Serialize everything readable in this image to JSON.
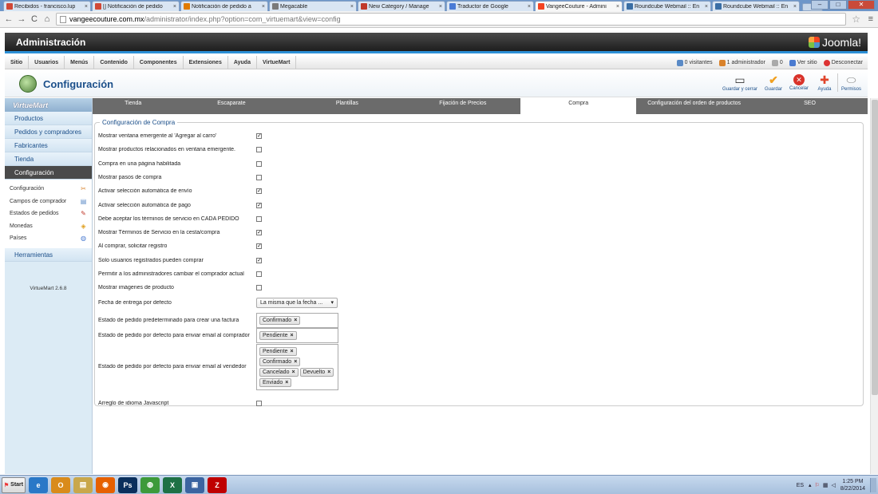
{
  "browser": {
    "tabs": [
      {
        "label": "Recibidos - francisco.lup",
        "icon": "gmail-icon",
        "color": "#d14836",
        "active": false
      },
      {
        "label": "[] Notificación de pedido",
        "icon": "gmail-icon",
        "color": "#d14836",
        "active": false
      },
      {
        "label": "Notificación de pedido a",
        "icon": "w-icon",
        "color": "#e07b00",
        "active": false
      },
      {
        "label": "Megacable",
        "icon": "megacable-icon",
        "color": "#7a7a7a",
        "active": false
      },
      {
        "label": "New Category / Manage",
        "icon": "manage-icon",
        "color": "#c0392b",
        "active": false
      },
      {
        "label": "Traductor de Google",
        "icon": "translate-icon",
        "color": "#4a7bd6",
        "active": false
      },
      {
        "label": "VangeeCouture - Admini",
        "icon": "joomla-icon",
        "color": "#f44321",
        "active": true
      },
      {
        "label": "Roundcube Webmail :: En",
        "icon": "roundcube-icon",
        "color": "#3a6ea5",
        "active": false
      },
      {
        "label": "Roundcube Webmail :: En",
        "icon": "roundcube-icon",
        "color": "#3a6ea5",
        "active": false
      }
    ],
    "url_host": "vangeecouture.com.mx",
    "url_path": "/administrator/index.php?option=com_virtuemart&view=config"
  },
  "header": {
    "title": "Administración",
    "logo": "Joomla!"
  },
  "menubar": {
    "items": [
      "Sitio",
      "Usuarios",
      "Menús",
      "Contenido",
      "Componentes",
      "Extensiones",
      "Ayuda",
      "VirtueMart"
    ],
    "visitors": "0 visitantes",
    "admins": "1 administrador",
    "messages": "0",
    "view_site": "Ver sitio",
    "logout": "Desconectar"
  },
  "page": {
    "title": "Configuración"
  },
  "toolbar": {
    "save_close": "Guardar y cerrar",
    "save": "Guardar",
    "cancel": "Cancelar",
    "help": "Ayuda",
    "permissions": "Permisos"
  },
  "sidebar": {
    "logo": "VirtueMart",
    "items": [
      "Productos",
      "Pedidos y compradores",
      "Fabricantes",
      "Tienda",
      "Configuración"
    ],
    "active_item": "Configuración",
    "subitems": [
      {
        "label": "Configuración",
        "icon": "tools-icon"
      },
      {
        "label": "Campos de comprador",
        "icon": "form-icon"
      },
      {
        "label": "Estados de pedidos",
        "icon": "status-icon"
      },
      {
        "label": "Monedas",
        "icon": "coins-icon"
      },
      {
        "label": "Países",
        "icon": "globe-icon"
      }
    ],
    "tools": "Herramientas",
    "version": "VirtueMart 2.6.8"
  },
  "tabs": [
    {
      "label": "Tienda",
      "active": false
    },
    {
      "label": "Escaparate",
      "active": false
    },
    {
      "label": "Plantillas",
      "active": false
    },
    {
      "label": "Fijación de Precios",
      "active": false
    },
    {
      "label": "Compra",
      "active": true
    },
    {
      "label": "Configuración del orden de productos",
      "active": false
    },
    {
      "label": "SEO",
      "active": false
    }
  ],
  "form": {
    "legend": "Configuración de Compra",
    "checkboxes": [
      {
        "label": "Mostrar ventana emergente al 'Agregar al carro'",
        "checked": true
      },
      {
        "label": "Mostrar productos relacionados en ventana emergente.",
        "checked": false
      },
      {
        "label": "Compra en una página habilitada",
        "checked": false
      },
      {
        "label": "Mostrar pasos de compra",
        "checked": false
      },
      {
        "label": "Activar selección automática de envío",
        "checked": true
      },
      {
        "label": "Activar selección automática de pago",
        "checked": true
      },
      {
        "label": "Debe aceptar los términos de servicio en CADA PEDIDO",
        "checked": false
      },
      {
        "label": "Mostrar Términos de Servicio en la cesta/compra",
        "checked": true
      },
      {
        "label": "Al comprar, solicitar registro",
        "checked": true
      },
      {
        "label": "Solo usuarios registrados pueden comprar",
        "checked": true
      },
      {
        "label": "Permitir a los administradores cambiar el comprador actual",
        "checked": false
      },
      {
        "label": "Mostrar imágenes de producto",
        "checked": false
      }
    ],
    "delivery": {
      "label": "Fecha de entrega por defecto",
      "value": "La misma que la fecha ..."
    },
    "invoice": {
      "label": "Estado de pedido predeterminado para crear una factura",
      "chips": [
        "Confirmado"
      ]
    },
    "email_buyer": {
      "label": "Estado de pedido por defecto para enviar email al comprador",
      "chips": [
        "Pendiente"
      ]
    },
    "email_vendor": {
      "label": "Estado de pedido por defecto para enviar email al vendedor",
      "chips": [
        "Pendiente",
        "Confirmado",
        "Cancelado",
        "Devuelto",
        "Enviado"
      ]
    },
    "js_fix": {
      "label": "Arreglo de idioma Javascript",
      "checked": false
    }
  },
  "taskbar": {
    "start": "Start",
    "apps": [
      {
        "icon": "ie-icon",
        "label": "e",
        "color": "#2a78c7"
      },
      {
        "icon": "outlook-icon",
        "label": "O",
        "color": "#d98b1b"
      },
      {
        "icon": "folder-icon",
        "label": "▤",
        "color": "#c9a74b"
      },
      {
        "icon": "firefox-icon",
        "label": "◉",
        "color": "#e66000"
      },
      {
        "icon": "photoshop-icon",
        "label": "Ps",
        "color": "#0a2f5c"
      },
      {
        "icon": "chrome-icon",
        "label": "◍",
        "color": "#3d9a3a"
      },
      {
        "icon": "excel-icon",
        "label": "X",
        "color": "#1e7145"
      },
      {
        "icon": "app-icon",
        "label": "▣",
        "color": "#3b64a0"
      },
      {
        "icon": "filezilla-icon",
        "label": "Z",
        "color": "#bf0000"
      }
    ],
    "lang": "ES",
    "time": "1:25 PM",
    "date": "8/22/2014"
  }
}
